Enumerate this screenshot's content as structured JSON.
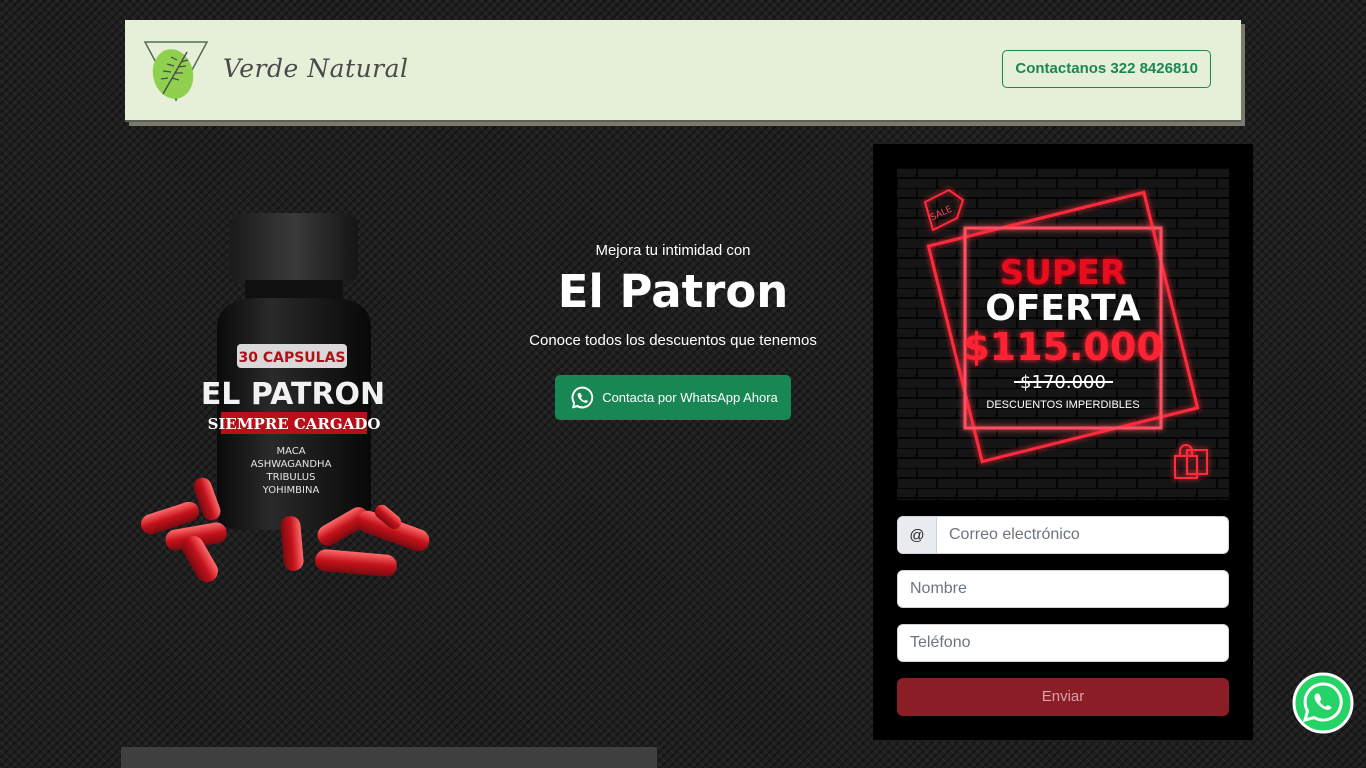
{
  "header": {
    "brand": "Verde Natural",
    "contact_label": "Contactanos 322 8426810"
  },
  "hero": {
    "pretitle": "Mejora tu intimidad con",
    "title": "El Patron",
    "subtitle": "Conoce todos los descuentos que tenemos",
    "whatsapp_label": "Contacta por WhatsApp Ahora"
  },
  "product": {
    "capsules": "30 CAPSULAS",
    "name": "EL PATRON",
    "tagline": "SIEMPRE CARGADO",
    "ingredients": [
      "MACA",
      "ASHWAGANDHA",
      "TRIBULUS",
      "YOHIMBINA"
    ]
  },
  "promo": {
    "sale_tag": "SALE",
    "super": "SUPER",
    "oferta": "OFERTA",
    "price": "$115.000",
    "old_price": "$170.000",
    "note": "DESCUENTOS IMPERDIBLES"
  },
  "form": {
    "email_prefix": "@",
    "email_placeholder": "Correo electrónico",
    "name_placeholder": "Nombre",
    "phone_placeholder": "Teléfono",
    "submit_label": "Enviar"
  },
  "colors": {
    "header_bg": "#e6f0d8",
    "brand_green": "#198754",
    "submit": "#8b1d26",
    "neon_red": "#ff1f2e"
  }
}
